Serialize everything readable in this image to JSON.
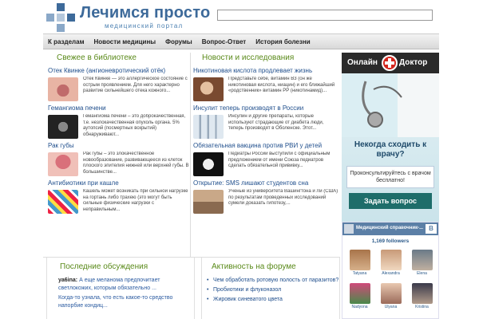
{
  "header": {
    "title": "Лечимся просто",
    "subtitle": "медицинский портал",
    "search_placeholder": ""
  },
  "nav": {
    "items": [
      "К разделам",
      "Новости медицины",
      "Форумы",
      "Вопрос-Ответ",
      "История болезни"
    ]
  },
  "library": {
    "heading": "Свежее в библиотеке",
    "articles": [
      {
        "title": "Отек Квинке (ангионевротический отёк)",
        "text": "Отек Квинке — это аллергическое состояние с острым проявлением. Для него характерно развитие сильнейшего отека кожного..."
      },
      {
        "title": "Гемангиома печени",
        "text": "Гемангиома печени – это доброкачественная, т.е. незлокачественная опухоль органа. 5% аутопсий (посмертных вскрытий) обнаруживают..."
      },
      {
        "title": "Рак губы",
        "text": "Рак губы – это злокачественное новообразование, развивающееся из клеток плоского эпителия нижней или верхней губы. В большинстве..."
      },
      {
        "title": "Антибиотики при кашле",
        "text": "Кашель может возникать при сильной нагрузке на гортань либо трахею (это могут быть сильные физические нагрузки с неправильным..."
      }
    ]
  },
  "news": {
    "heading": "Новости и исследования",
    "articles": [
      {
        "title": "Никотиновая кислота продлевает жизнь",
        "text": "Представьте себе, витамин В3 (он же никотиновая кислота, ниацин) и его ближайший «родственник» витамин РР (никотинамид)..."
      },
      {
        "title": "Инсулит теперь производят в России",
        "text": "Инсулин и другие препараты, которые используют страдающие от диабета люди, теперь производят в Оболенске. Этот..."
      },
      {
        "title": "Обязательная вакцина против РВИ у детей",
        "text": "Педиатры России выступили с официальным предложением от имени Союза педиатров сделать обязательной прививку..."
      },
      {
        "title": "Открытие: SMS лишают студентов сна",
        "text": "Ученые из университета Вашингтона и Ли (США) по результатам проведенных исследований сумели доказать гипотезу,..."
      }
    ]
  },
  "doctor_banner": {
    "head_left": "Онлайн",
    "head_right": "Доктор",
    "question": "Некогда сходить к врачу?",
    "box_text": "Проконсультируйтесь с врачом бесплатно!",
    "button": "Задать вопрос"
  },
  "vk": {
    "title": "Медицинский справочник-...",
    "logo": "В",
    "followers": "1,169 followers",
    "friends": [
      "Tatyana",
      "Alexandra",
      "Elena",
      "Nadyona",
      "Ulyana",
      "Kristina"
    ]
  },
  "discussions": {
    "heading": "Последние обсуждения",
    "items": [
      {
        "user": "ya6ina:",
        "text": "А еще меланома предпочитает светлокожих, которым обязательно ..."
      },
      {
        "user": "",
        "text": "Когда-то узнала, что есть какое-то средство напорбие кондиц..."
      }
    ]
  },
  "forum": {
    "heading": "Активность на форуме",
    "items": [
      "Чем обработать ротовую полость от паразитов?",
      "Пробиотики и флуконазол",
      "Жировик синеватого цвета"
    ]
  },
  "colors": {
    "link": "#1f4e8c",
    "heading": "#5a8a1a",
    "brand": "#3d6a9a",
    "doctor_button": "#1e6d6a",
    "doctor_red": "#d4261d"
  }
}
